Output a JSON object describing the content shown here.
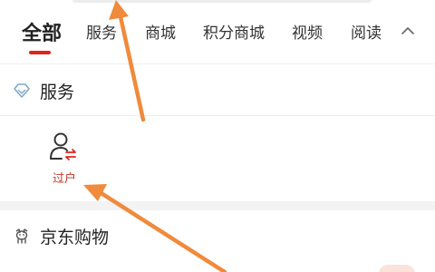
{
  "tabs": [
    {
      "label": "全部",
      "active": true
    },
    {
      "label": "服务",
      "active": false
    },
    {
      "label": "商城",
      "active": false
    },
    {
      "label": "积分商城",
      "active": false
    },
    {
      "label": "视频",
      "active": false
    },
    {
      "label": "阅读",
      "active": false
    }
  ],
  "collapse_icon": "chevron-up-icon",
  "sections": {
    "service": {
      "title": "服务",
      "icon": "diamond-icon",
      "items": [
        {
          "label": "过户",
          "icon": "user-transfer-icon"
        }
      ]
    },
    "jd_shopping": {
      "title": "京东购物",
      "icon": "jd-dog-icon"
    }
  },
  "colors": {
    "accent": "#e2231a",
    "annotation_arrow": "#f08a3c",
    "label_red": "#c0392b"
  }
}
